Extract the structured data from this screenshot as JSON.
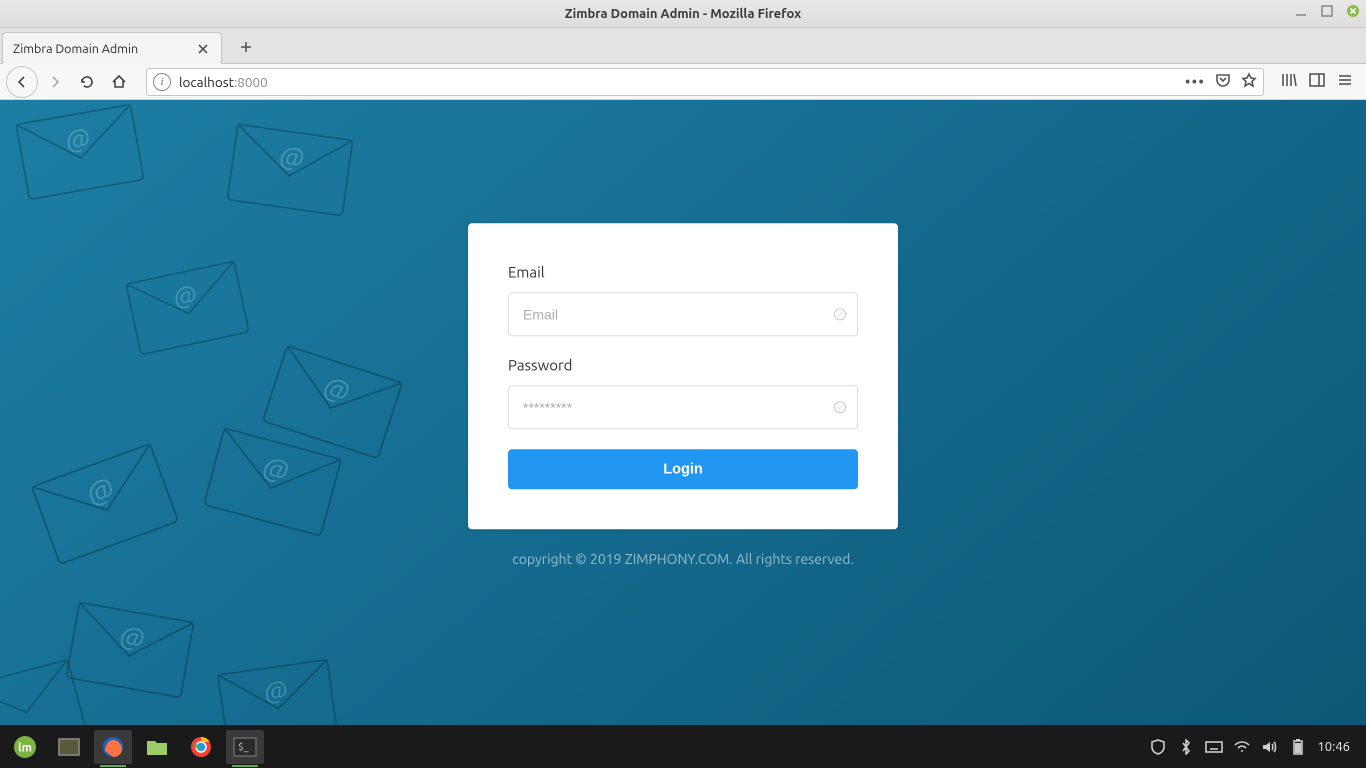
{
  "window": {
    "title": "Zimbra Domain Admin - Mozilla Firefox"
  },
  "tab": {
    "label": "Zimbra Domain Admin"
  },
  "url": {
    "host": "localhost",
    "port": ":8000"
  },
  "login": {
    "email_label": "Email",
    "email_placeholder": "Email",
    "password_label": "Password",
    "password_placeholder": "*********",
    "button": "Login"
  },
  "footer": {
    "copyright": "copyright © 2019 ZIMPHONY.COM. All rights reserved."
  },
  "tray": {
    "clock": "10:46"
  }
}
